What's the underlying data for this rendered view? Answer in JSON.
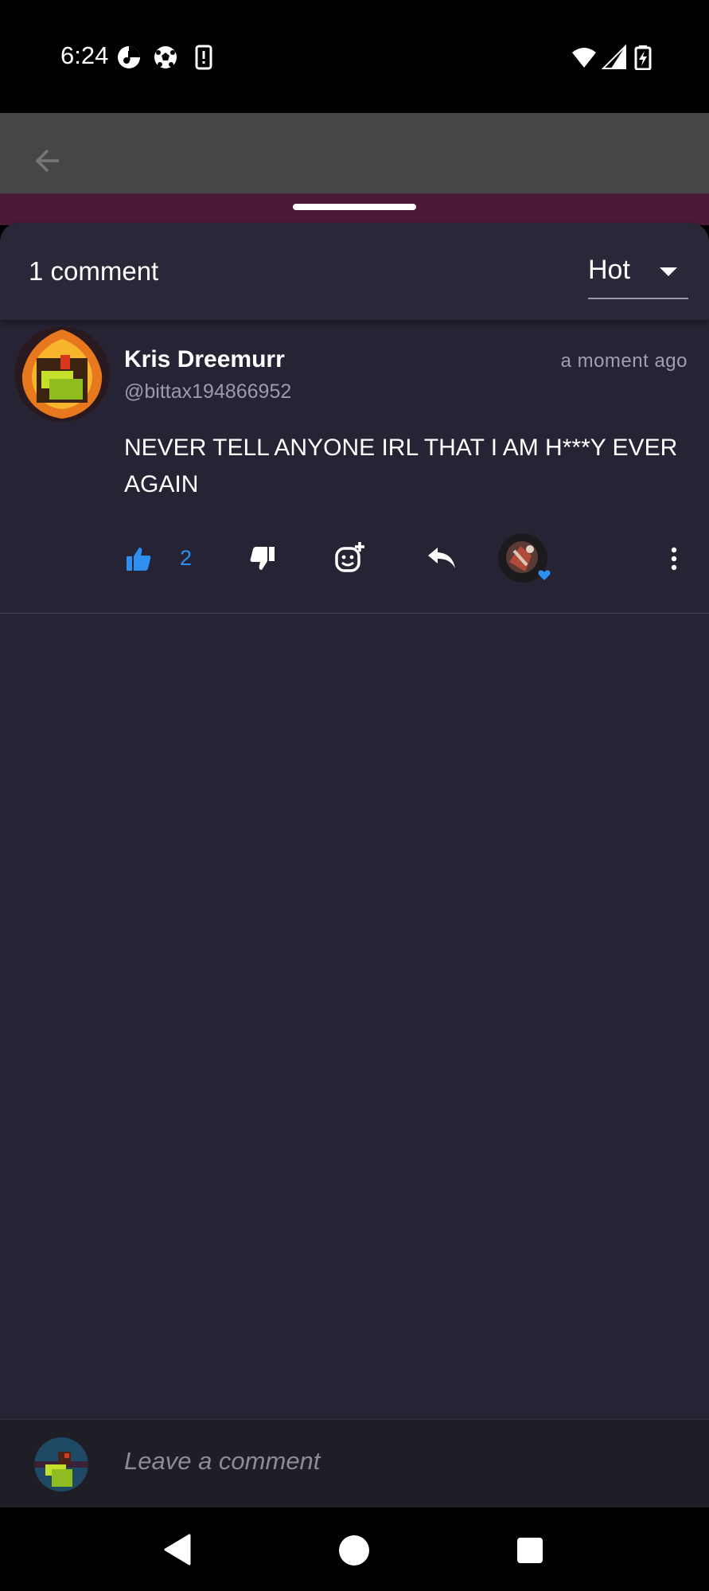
{
  "status_bar": {
    "time": "6:24",
    "left_icons": [
      "music-app-icon",
      "soccer-ball-icon",
      "phone-alert-icon"
    ],
    "right_icons": [
      "wifi-icon",
      "signal-icon",
      "battery-charging-icon"
    ]
  },
  "app_header": {
    "back_icon": "arrow-back-icon"
  },
  "comments_sheet": {
    "count_label": "1 comment",
    "sort": {
      "selected": "Hot"
    }
  },
  "comments": [
    {
      "author": "Kris Dreemurr",
      "handle": "@bittax194866952",
      "timestamp": "a moment ago",
      "text": "NEVER TELL ANYONE IRL THAT I AM H***Y EVER AGAIN",
      "likes": "2"
    }
  ],
  "composer": {
    "placeholder": "Leave a comment"
  },
  "colors": {
    "accent": "#2d8ff0",
    "sheet_bg": "#262434",
    "composer_bg": "#1f1e26"
  }
}
